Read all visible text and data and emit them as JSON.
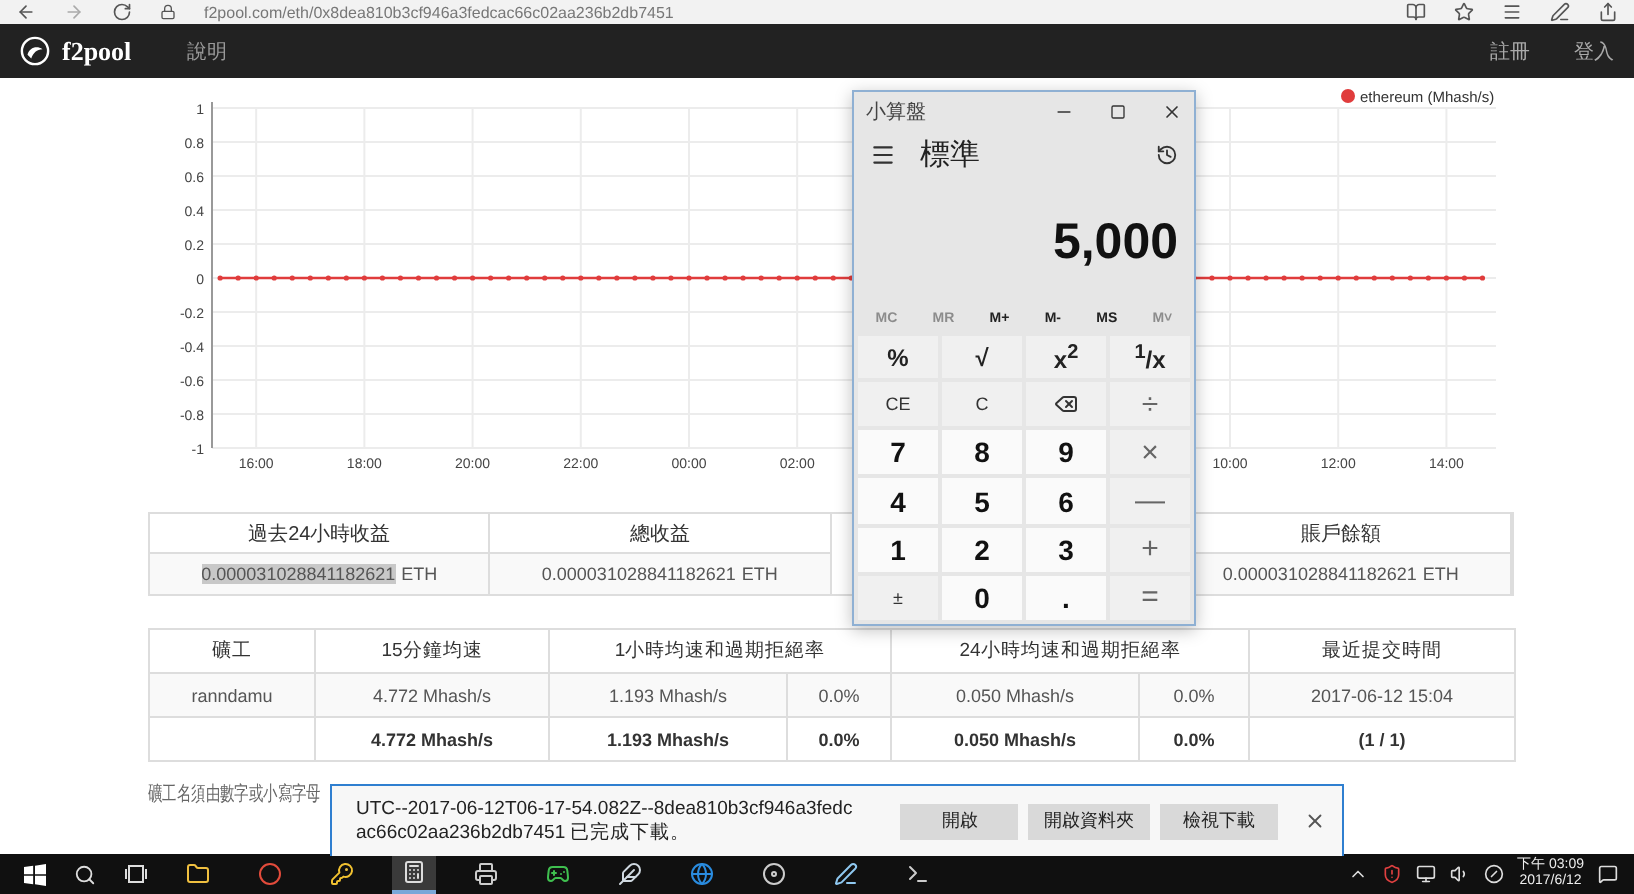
{
  "browser": {
    "url": "f2pool.com/eth/0x8dea810b3cf946a3fedcac66c02aa236b2db7451"
  },
  "nav": {
    "brand": "f2pool",
    "links": [
      "說明"
    ],
    "right_links": [
      "註冊",
      "登入"
    ]
  },
  "chart": {
    "chart_data": {
      "type": "line",
      "ylim": [
        -1,
        1
      ],
      "grid": true,
      "yticks": [
        1,
        0.8,
        0.6,
        0.4,
        0.2,
        0,
        -0.2,
        -0.4,
        -0.6,
        -0.8,
        -1
      ],
      "categories": [
        null,
        null,
        "16:00",
        null,
        null,
        null,
        null,
        null,
        "18:00",
        null,
        null,
        null,
        null,
        null,
        "20:00",
        null,
        null,
        null,
        null,
        null,
        "22:00",
        null,
        null,
        null,
        null,
        null,
        "00:00",
        null,
        null,
        null,
        null,
        null,
        "02:00",
        null,
        null,
        null,
        null,
        null,
        null,
        null,
        null,
        null,
        null,
        null,
        null,
        null,
        null,
        null,
        null,
        null,
        null,
        null,
        null,
        null,
        null,
        null,
        "10:00",
        null,
        null,
        null,
        null,
        null,
        "12:00",
        null,
        null,
        null,
        null,
        null,
        "14:00",
        null,
        null
      ],
      "series": [
        {
          "name": "ethereum (Mhash/s)",
          "color": "#e03c3c",
          "values": [
            0,
            0,
            0,
            0,
            0,
            0,
            0,
            0,
            0,
            0,
            0,
            0,
            0,
            0,
            0,
            0,
            0,
            0,
            0,
            0,
            0,
            0,
            0,
            0,
            0,
            0,
            0,
            0,
            0,
            0,
            0,
            0,
            0,
            0,
            0,
            0,
            null,
            null,
            null,
            null,
            null,
            null,
            null,
            null,
            null,
            null,
            null,
            null,
            null,
            null,
            null,
            null,
            null,
            null,
            0,
            0,
            0,
            0,
            0,
            0,
            0,
            0,
            0,
            0,
            0,
            0,
            0,
            0,
            0,
            0,
            0
          ]
        }
      ]
    }
  },
  "earnings_table": {
    "columns": [
      {
        "header": "過去24小時收益",
        "value": "0.000031028841182621",
        "unit": "ETH",
        "highlighted": true,
        "gap_before": false
      },
      {
        "header": "總收益",
        "value": "0.000031028841182621",
        "unit": "ETH",
        "highlighted": false,
        "gap_before": false
      },
      {
        "header": "賬戶餘額",
        "value": "0.000031028841182621",
        "unit": "ETH",
        "highlighted": false,
        "gap_before": true
      }
    ]
  },
  "workers_table": {
    "headers": [
      {
        "label": "礦工",
        "wide": false
      },
      {
        "label": "15分鐘均速",
        "wide": false
      },
      {
        "label": "1小時均速和過期拒絕率",
        "wide": true
      },
      {
        "label": "24小時均速和過期拒絕率",
        "wide": true
      },
      {
        "label": "最近提交時間",
        "wide": false
      }
    ],
    "rows": [
      {
        "kind": "worker",
        "label": "ranndamu",
        "cells": [
          "4.772 Mhash/s",
          "1.193 Mhash/s",
          "0.0%",
          "0.050 Mhash/s",
          "0.0%",
          "2017-06-12 15:04"
        ]
      },
      {
        "kind": "total",
        "cells": [
          "4.772 Mhash/s",
          "1.193 Mhash/s",
          "0.0%",
          "0.050 Mhash/s",
          "0.0%",
          "(1 / 1)"
        ]
      }
    ]
  },
  "note": "礦工名須由數字或小寫字母",
  "calculator": {
    "title": "小算盤",
    "mode": "標準",
    "display": "5,000",
    "memory": [
      {
        "label": "MC",
        "disabled": true
      },
      {
        "label": "MR",
        "disabled": true
      },
      {
        "label": "M+",
        "disabled": false
      },
      {
        "label": "M-",
        "disabled": false
      },
      {
        "label": "MS",
        "disabled": false
      },
      {
        "label": "M˅",
        "disabled": true
      }
    ],
    "keys": [
      {
        "label": "%",
        "kind": "function"
      },
      {
        "label": "√",
        "kind": "function"
      },
      {
        "label": "x$^{2}$",
        "kind": "function"
      },
      {
        "label": "$^{1}$/x",
        "kind": "function"
      },
      {
        "label": "CE",
        "kind": "small"
      },
      {
        "label": "C",
        "kind": "small"
      },
      {
        "kind": "backspace"
      },
      {
        "label": "÷",
        "kind": "operator"
      },
      {
        "label": "7",
        "kind": "digit"
      },
      {
        "label": "8",
        "kind": "digit"
      },
      {
        "label": "9",
        "kind": "digit"
      },
      {
        "label": "×",
        "kind": "operator"
      },
      {
        "label": "4",
        "kind": "digit"
      },
      {
        "label": "5",
        "kind": "digit"
      },
      {
        "label": "6",
        "kind": "digit"
      },
      {
        "label": "—",
        "kind": "operator"
      },
      {
        "label": "1",
        "kind": "digit"
      },
      {
        "label": "2",
        "kind": "digit"
      },
      {
        "label": "3",
        "kind": "digit"
      },
      {
        "label": "+",
        "kind": "operator"
      },
      {
        "label": "±",
        "kind": "small"
      },
      {
        "label": "0",
        "kind": "digit"
      },
      {
        "label": ".",
        "kind": "digit"
      },
      {
        "label": "=",
        "kind": "operator"
      }
    ]
  },
  "download_bar": {
    "message": "UTC--2017-06-12T06-17-54.082Z--8dea810b3cf946a3fedcac66c02aa236b2db7451 已完成下載。",
    "buttons": [
      "開啟",
      "開啟資料夾",
      "檢視下載"
    ]
  },
  "taskbar": {
    "time": "下午 03:09",
    "date": "2017/6/12"
  }
}
